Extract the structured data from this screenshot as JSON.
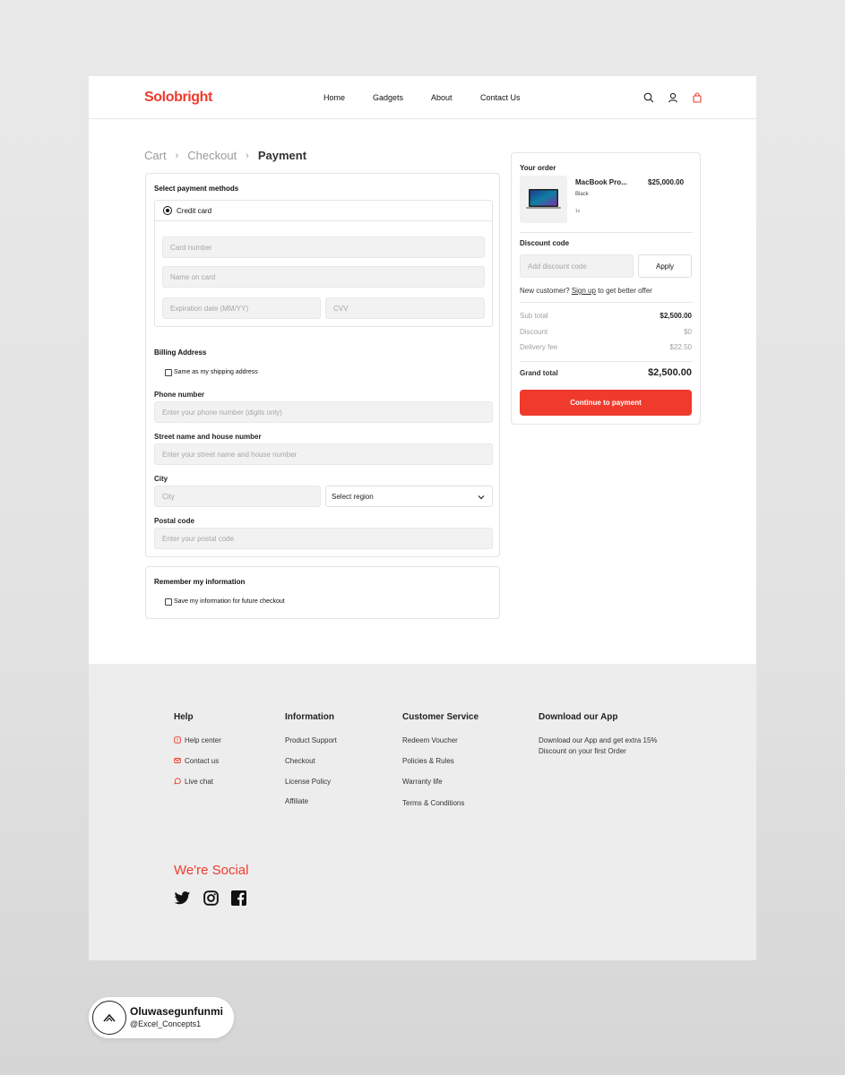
{
  "brand": {
    "name": "Solobright",
    "accent": "#ef3b2d"
  },
  "nav": {
    "items": [
      "Home",
      "Gadgets",
      "About",
      "Contact Us"
    ]
  },
  "header_icons": [
    "search-icon",
    "user-icon",
    "bag-icon"
  ],
  "breadcrumb": {
    "items": [
      "Cart",
      "Checkout",
      "Payment"
    ]
  },
  "payment": {
    "title": "Select payment methods",
    "method": "Credit card",
    "card_number_placeholder": "Card number",
    "name_placeholder": "Name on card",
    "expiry_placeholder": "Expiration date (MM/YY)",
    "cvv_placeholder": "CVV"
  },
  "billing": {
    "title": "Billing Address",
    "same_address_label": "Same as my shipping address",
    "phone_label": "Phone number",
    "phone_placeholder": "Enter your phone number (digits only)",
    "street_label": "Street name and house number",
    "street_placeholder": "Enter your street name and house number",
    "city_label": "City",
    "city_placeholder": "City",
    "region_select": "Select region",
    "postal_label": "Postal code",
    "postal_placeholder": "Enter your postal code"
  },
  "remember": {
    "title": "Remember my information",
    "save_label": "Save my information for future checkout"
  },
  "order": {
    "title": "Your order",
    "product_name": "MacBook Pro...",
    "product_price": "$25,000.00",
    "product_color": "Black",
    "product_qty": "1x",
    "discount_label": "Discount code",
    "discount_placeholder": "Add discount code",
    "apply_label": "Apply",
    "new_customer_prefix": "New customer?",
    "signup_link": "Sign up",
    "new_customer_suffix": "to get better offer",
    "subtotal_label": "Sub total",
    "subtotal_value": "$2,500.00",
    "discount_row_label": "Discount",
    "discount_value": "$0",
    "delivery_label": "Delivery fee",
    "delivery_value": "$22.50",
    "grand_label": "Grand total",
    "grand_value": "$2,500.00",
    "continue_label": "Continue to payment"
  },
  "footer": {
    "help": {
      "title": "Help",
      "items": [
        "Help center",
        "Contact us",
        "Live chat"
      ]
    },
    "information": {
      "title": "Information",
      "items": [
        "Product Support",
        "Checkout",
        "License Policy",
        "Affiliate"
      ]
    },
    "customer_service": {
      "title": "Customer Service",
      "items": [
        "Redeem Voucher",
        "Policies & Rules",
        "Warranty life",
        "Terms & Conditions"
      ]
    },
    "app": {
      "title": "Download our App",
      "line1": "Download our App and get extra 15%",
      "line2": "Discount on your first Order"
    },
    "social_title": "We're Social",
    "social_icons": [
      "twitter-icon",
      "instagram-icon",
      "facebook-icon"
    ]
  },
  "credit": {
    "name": "Oluwasegunfunmi",
    "handle": "@Excel_Concepts1"
  }
}
